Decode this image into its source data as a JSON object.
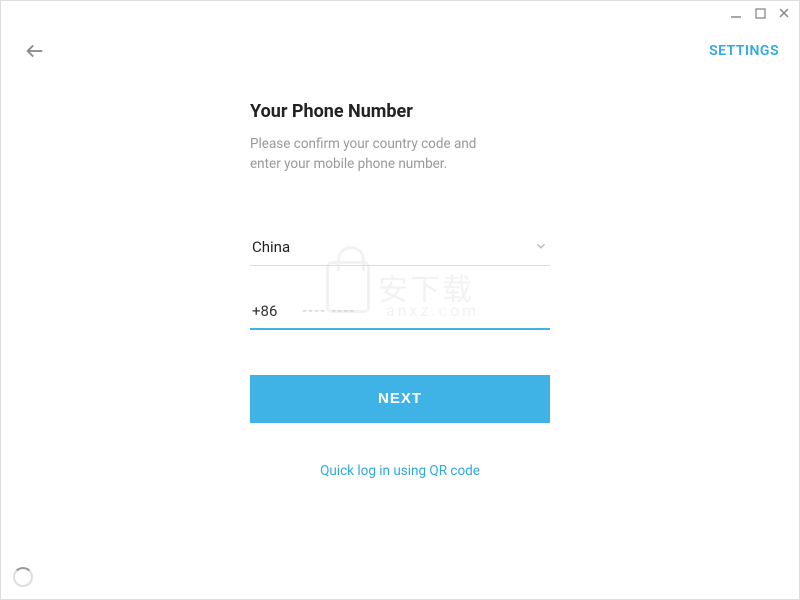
{
  "header": {
    "settings_label": "SETTINGS"
  },
  "form": {
    "title": "Your Phone Number",
    "subtitle_line1": "Please confirm your country code and",
    "subtitle_line2": "enter your mobile phone number.",
    "country_name": "China",
    "country_code": "+86",
    "phone_value": "",
    "phone_placeholder": "---- ----",
    "next_label": "NEXT",
    "qr_link_label": "Quick log in using QR code"
  },
  "colors": {
    "accent": "#40b3e6",
    "link": "#2fa9e2"
  }
}
